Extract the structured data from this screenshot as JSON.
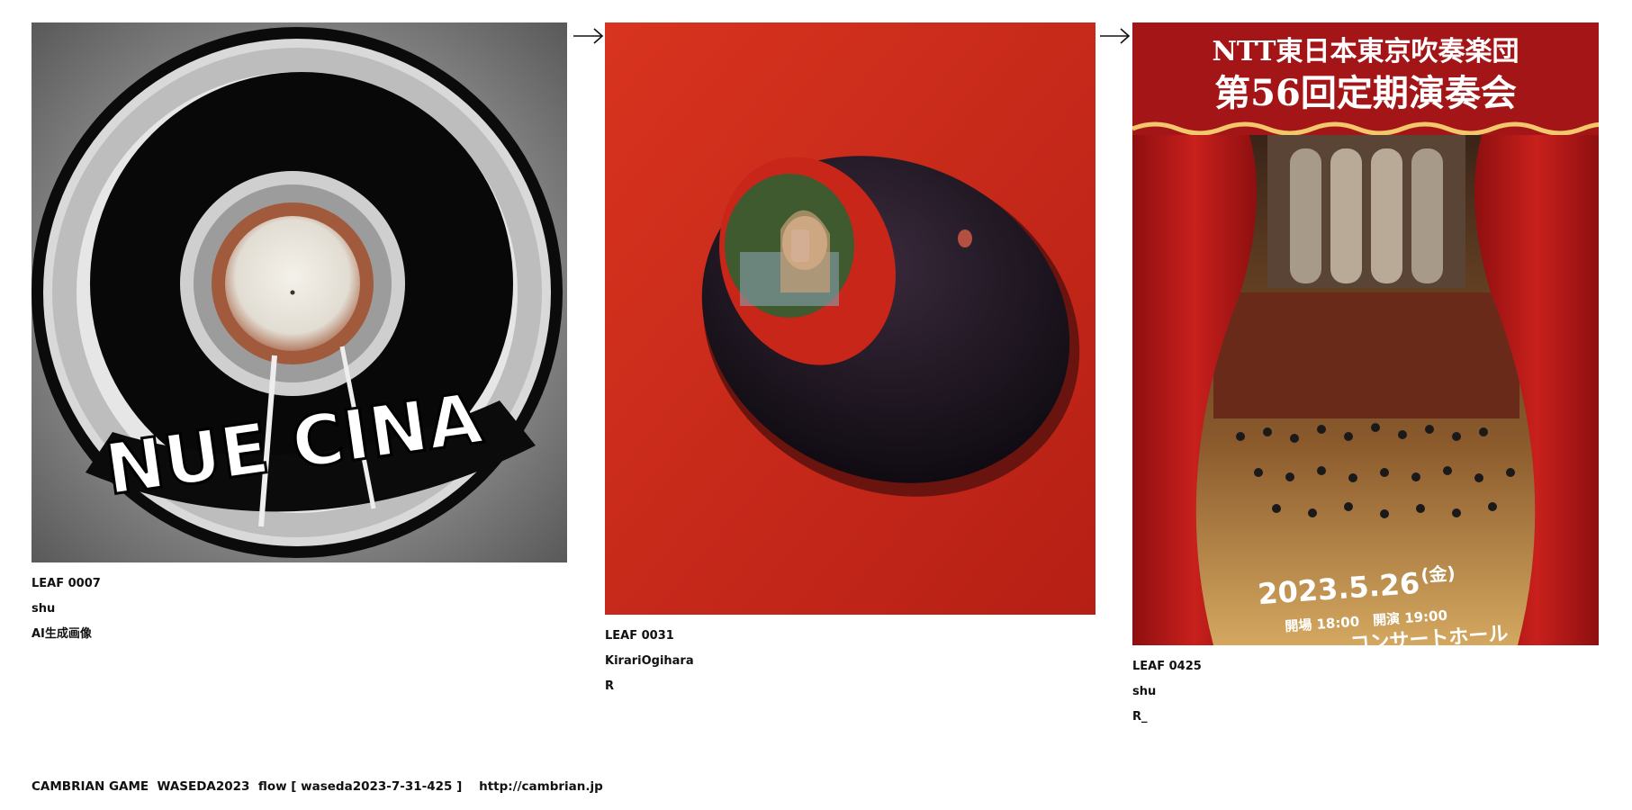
{
  "leaves": [
    {
      "id": "LEAF 0007",
      "author": "shu",
      "caption": "AI生成画像",
      "image": "black and white vinyl record disc with stylized lettering"
    },
    {
      "id": "LEAF 0031",
      "author": "KirariOgihara",
      "caption": "R",
      "image": "person seen through a round hole in a red wall"
    },
    {
      "id": "LEAF 0425",
      "author": "shu",
      "caption": "R_",
      "image": "concert poster with red curtains and orchestra on stage"
    }
  ],
  "poster": {
    "line1": "NTT東日本東京吹奏楽団",
    "line2": "第56回定期演奏会",
    "date": "2023.5.26",
    "weekday": "(金)",
    "times": "開場 18:00　開演 19:00",
    "venue": "コンサートホール"
  },
  "record_lettering": "NUE CINA",
  "footer": "CAMBRIAN GAME  WASEDA2023  flow [ waseda2023-7-31-425 ]    http://cambrian.jp",
  "colors": {
    "red_wall": "#cc2a1c",
    "curtain": "#b51a1a",
    "poster_gold": "#f3c76b"
  }
}
